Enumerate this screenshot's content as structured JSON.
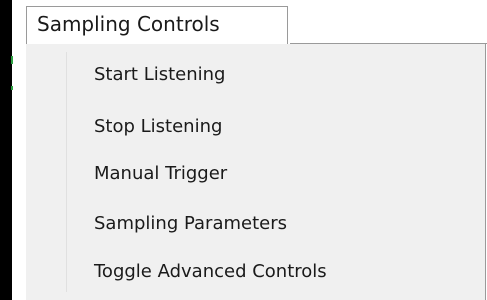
{
  "menu": {
    "title": "Sampling Controls",
    "items": [
      {
        "label": "Start Listening"
      },
      {
        "label": "Stop Listening"
      },
      {
        "label": "Manual Trigger"
      },
      {
        "label": "Sampling Parameters"
      },
      {
        "label": "Toggle Advanced Controls"
      }
    ]
  }
}
